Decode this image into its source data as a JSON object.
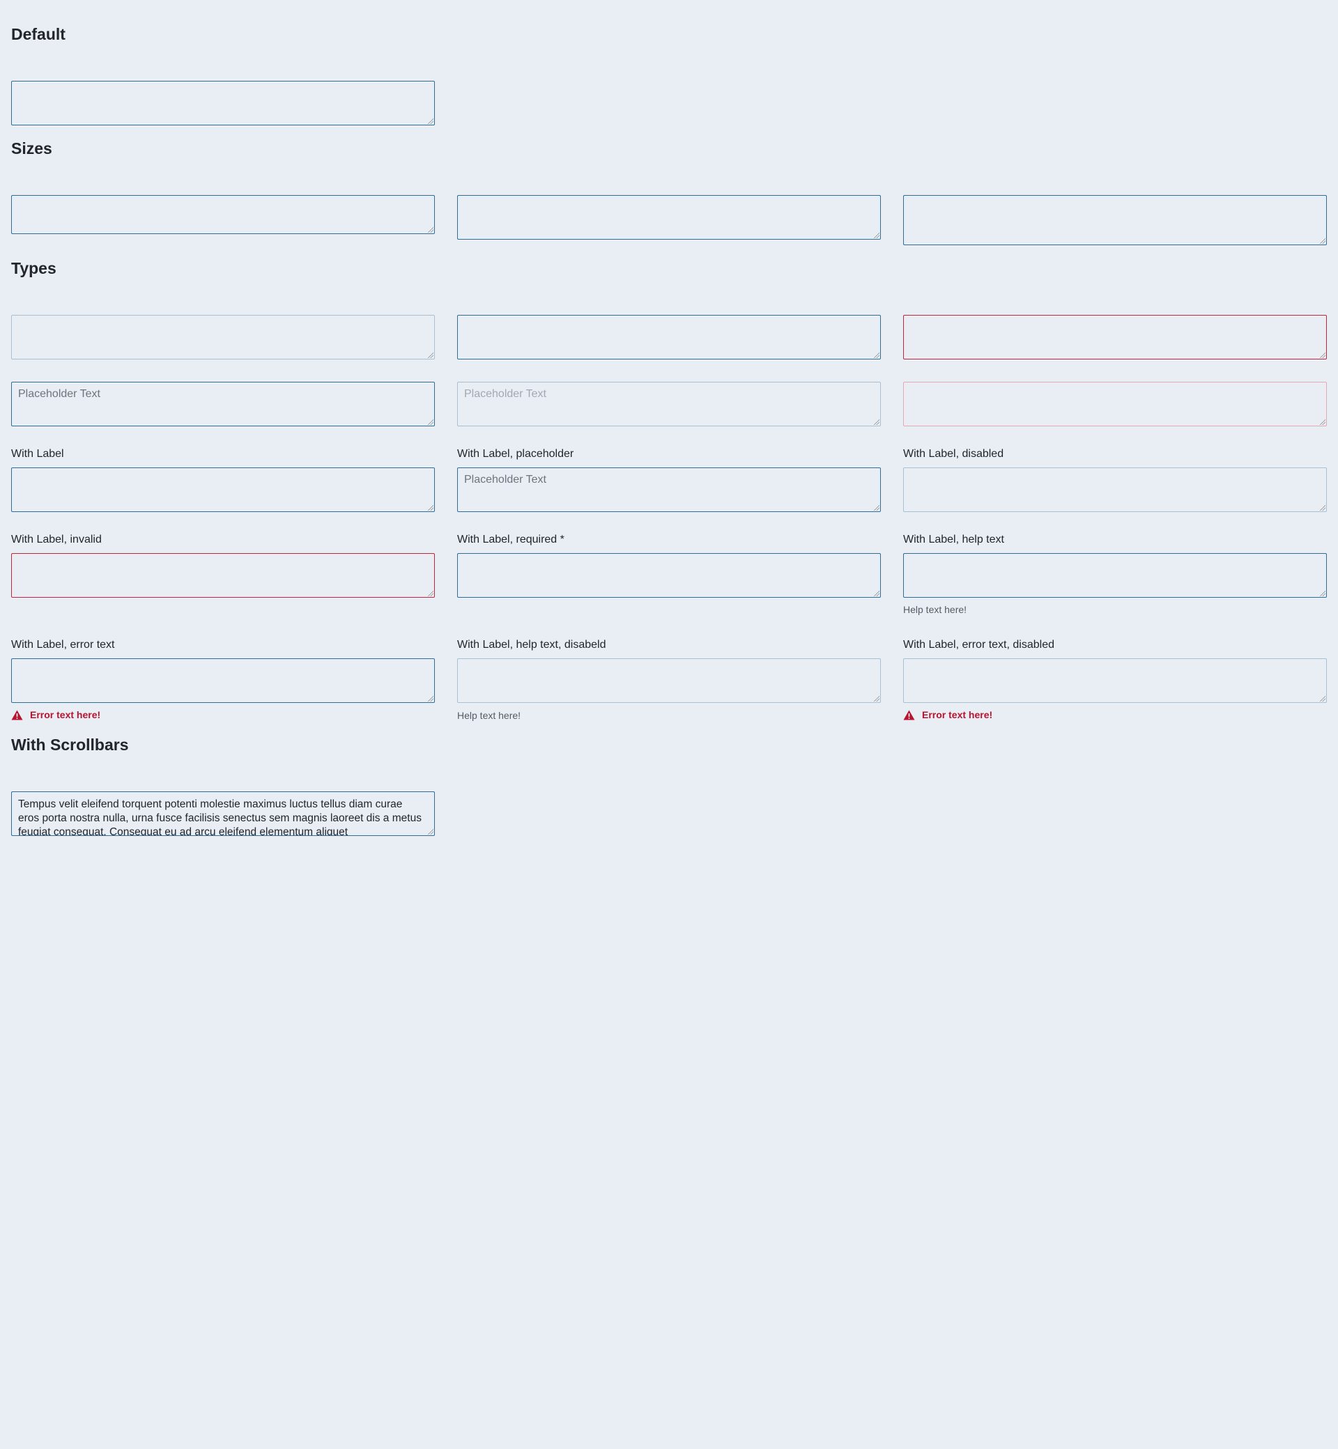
{
  "sections": {
    "default": "Default",
    "sizes": "Sizes",
    "types": "Types",
    "scrollbars": "With Scrollbars"
  },
  "placeholder": "Placeholder Text",
  "labels": {
    "with_label": "With Label",
    "with_label_placeholder": "With Label, placeholder",
    "with_label_disabled": "With Label, disabled",
    "with_label_invalid": "With Label, invalid",
    "with_label_required": "With Label, required *",
    "with_label_help": "With Label, help text",
    "with_label_error": "With Label, error text",
    "with_label_help_disabled": "With Label, help text, disabeld",
    "with_label_error_disabled": "With Label, error text, disabled"
  },
  "help_text": "Help text here!",
  "error_text": "Error text here!",
  "scroll_text": "Tempus velit eleifend torquent potenti molestie maximus luctus tellus diam curae eros porta nostra nulla, urna fusce facilisis senectus sem magnis laoreet dis a metus feugiat consequat. Consequat eu ad arcu eleifend elementum aliquet",
  "colors": {
    "background": "#e9edf4",
    "border": "#2e6e96",
    "border_disabled": "#a8c0cf",
    "invalid": "#c2243a",
    "error_text": "#b8132f"
  }
}
